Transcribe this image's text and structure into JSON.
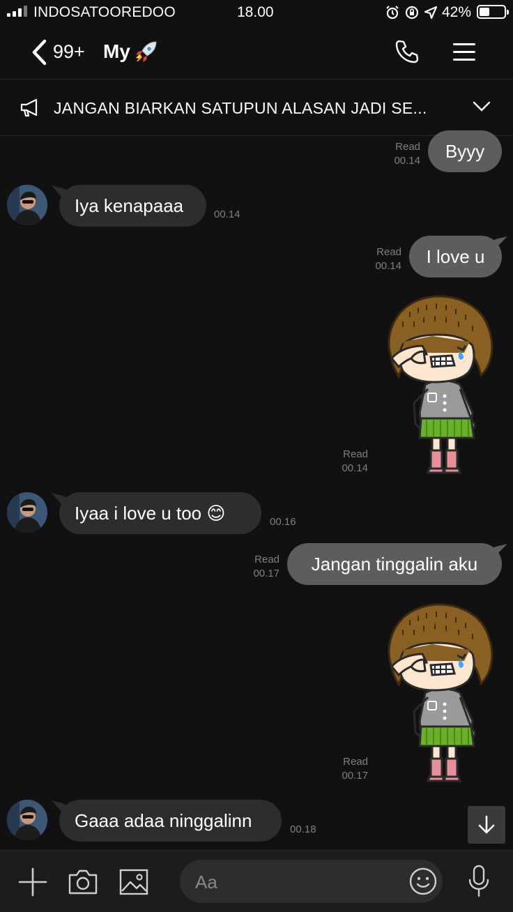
{
  "status_bar": {
    "carrier": "INDOSATOOREDOO",
    "time": "18.00",
    "battery": "42%"
  },
  "header": {
    "unread_count": "99+",
    "chat_name": "My"
  },
  "announcement": {
    "text": "JANGAN BIARKAN SATUPUN ALASAN JADI SE..."
  },
  "messages": [
    {
      "side": "out",
      "type": "text",
      "text": "Byyy",
      "read": "Read",
      "time": "00.14"
    },
    {
      "side": "in",
      "type": "text",
      "text": "Iya kenapaaa",
      "time": "00.14"
    },
    {
      "side": "out",
      "type": "text",
      "text": "I love u",
      "read": "Read",
      "time": "00.14"
    },
    {
      "side": "out",
      "type": "sticker",
      "sticker": "crying-girl-sticker",
      "read": "Read",
      "time": "00.14"
    },
    {
      "side": "in",
      "type": "text",
      "text": "Iyaa i love u too 😊",
      "time": "00.16"
    },
    {
      "side": "out",
      "type": "text",
      "text": "Jangan tinggalin aku",
      "read": "Read",
      "time": "00.17"
    },
    {
      "side": "out",
      "type": "sticker",
      "sticker": "crying-girl-sticker",
      "read": "Read",
      "time": "00.17"
    },
    {
      "side": "in",
      "type": "text",
      "text": "Gaaa adaa ninggalinn",
      "time": "00.18"
    }
  ],
  "composer": {
    "placeholder": "Aa"
  },
  "colors": {
    "background": "#111112",
    "incoming_bubble": "#2d2d2f",
    "outgoing_bubble": "#5d5d60"
  }
}
